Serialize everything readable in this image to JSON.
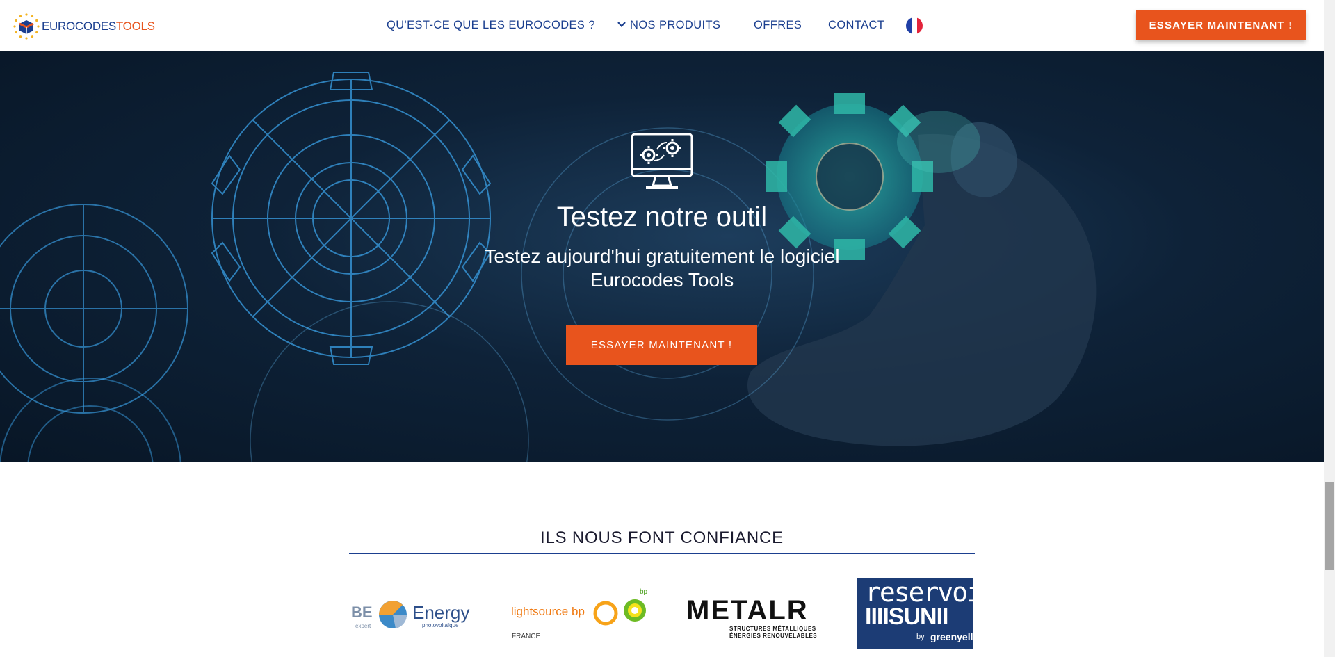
{
  "header": {
    "logo_part1": "EUROCODES",
    "logo_part2": "TOOLS",
    "nav": [
      {
        "label": "QU'EST-CE QUE LES EUROCODES ?"
      },
      {
        "label": "NOS PRODUITS"
      },
      {
        "label": "OFFRES"
      },
      {
        "label": "CONTACT"
      }
    ],
    "language": "fr",
    "cta": "ESSAYER MAINTENANT !"
  },
  "hero": {
    "icon": "monitor-gears-icon",
    "title": "Testez notre outil",
    "subtitle": "Testez aujourd'hui gratuitement le logiciel Eurocodes Tools",
    "cta": "ESSAYER MAINTENANT !"
  },
  "trust": {
    "title": "ILS NOUS FONT CONFIANCE",
    "partners": [
      {
        "line1": "BE",
        "line1b": "expert",
        "line2": "Energy",
        "line3": "photovoltaïque"
      },
      {
        "name": "lightsource",
        "name2": "bp",
        "mark": "bp",
        "sub": "FRANCE"
      },
      {
        "name": "METALR",
        "sub1": "STRUCTURES MÉTALLIQUES",
        "sub2": "ÉNERGIES RENOUVELABLES"
      },
      {
        "line1": "reservoi",
        "line2": "IIIISUNII",
        "by": "by",
        "brand": "greenyell"
      }
    ]
  },
  "colors": {
    "brand_blue": "#1b3f8f",
    "brand_orange": "#e8541d",
    "hero_dark": "#0e2238",
    "gear_glow": "#3aa0e6",
    "gear_teal": "#2fc7b5"
  }
}
